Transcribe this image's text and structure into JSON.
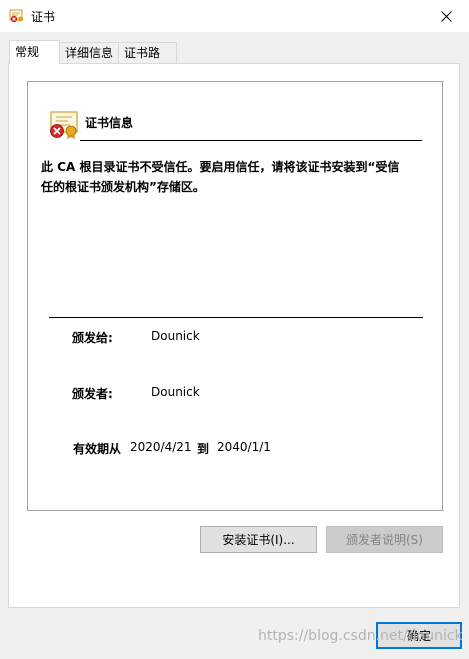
{
  "window": {
    "title": "证书"
  },
  "tabs": [
    {
      "label": "常规",
      "active": true
    },
    {
      "label": "详细信息",
      "active": false
    },
    {
      "label": "证书路径",
      "active": false
    }
  ],
  "general": {
    "heading": "证书信息",
    "warning_line1": "此 CA 根目录证书不受信任。要启用信任，请将该证书安装到“受信",
    "warning_line2": "任的根证书颁发机构”存储区。",
    "issued_to_label": "颁发给:",
    "issued_to_value": "Dounick",
    "issued_by_label": "颁发者:",
    "issued_by_value": "Dounick",
    "validity_from_label": "有效期从",
    "validity_from_value": "2020/4/21",
    "validity_to_label": "到",
    "validity_to_value": "2040/1/1"
  },
  "buttons": {
    "install": "安装证书(I)...",
    "issuer_statement": "颁发者说明(S)",
    "ok": "确定"
  },
  "watermark": "https://blog.csdn.net/dounick",
  "icons": {
    "title": "certificate-icon",
    "close": "close-icon",
    "cert_status": "certificate-error-icon"
  }
}
